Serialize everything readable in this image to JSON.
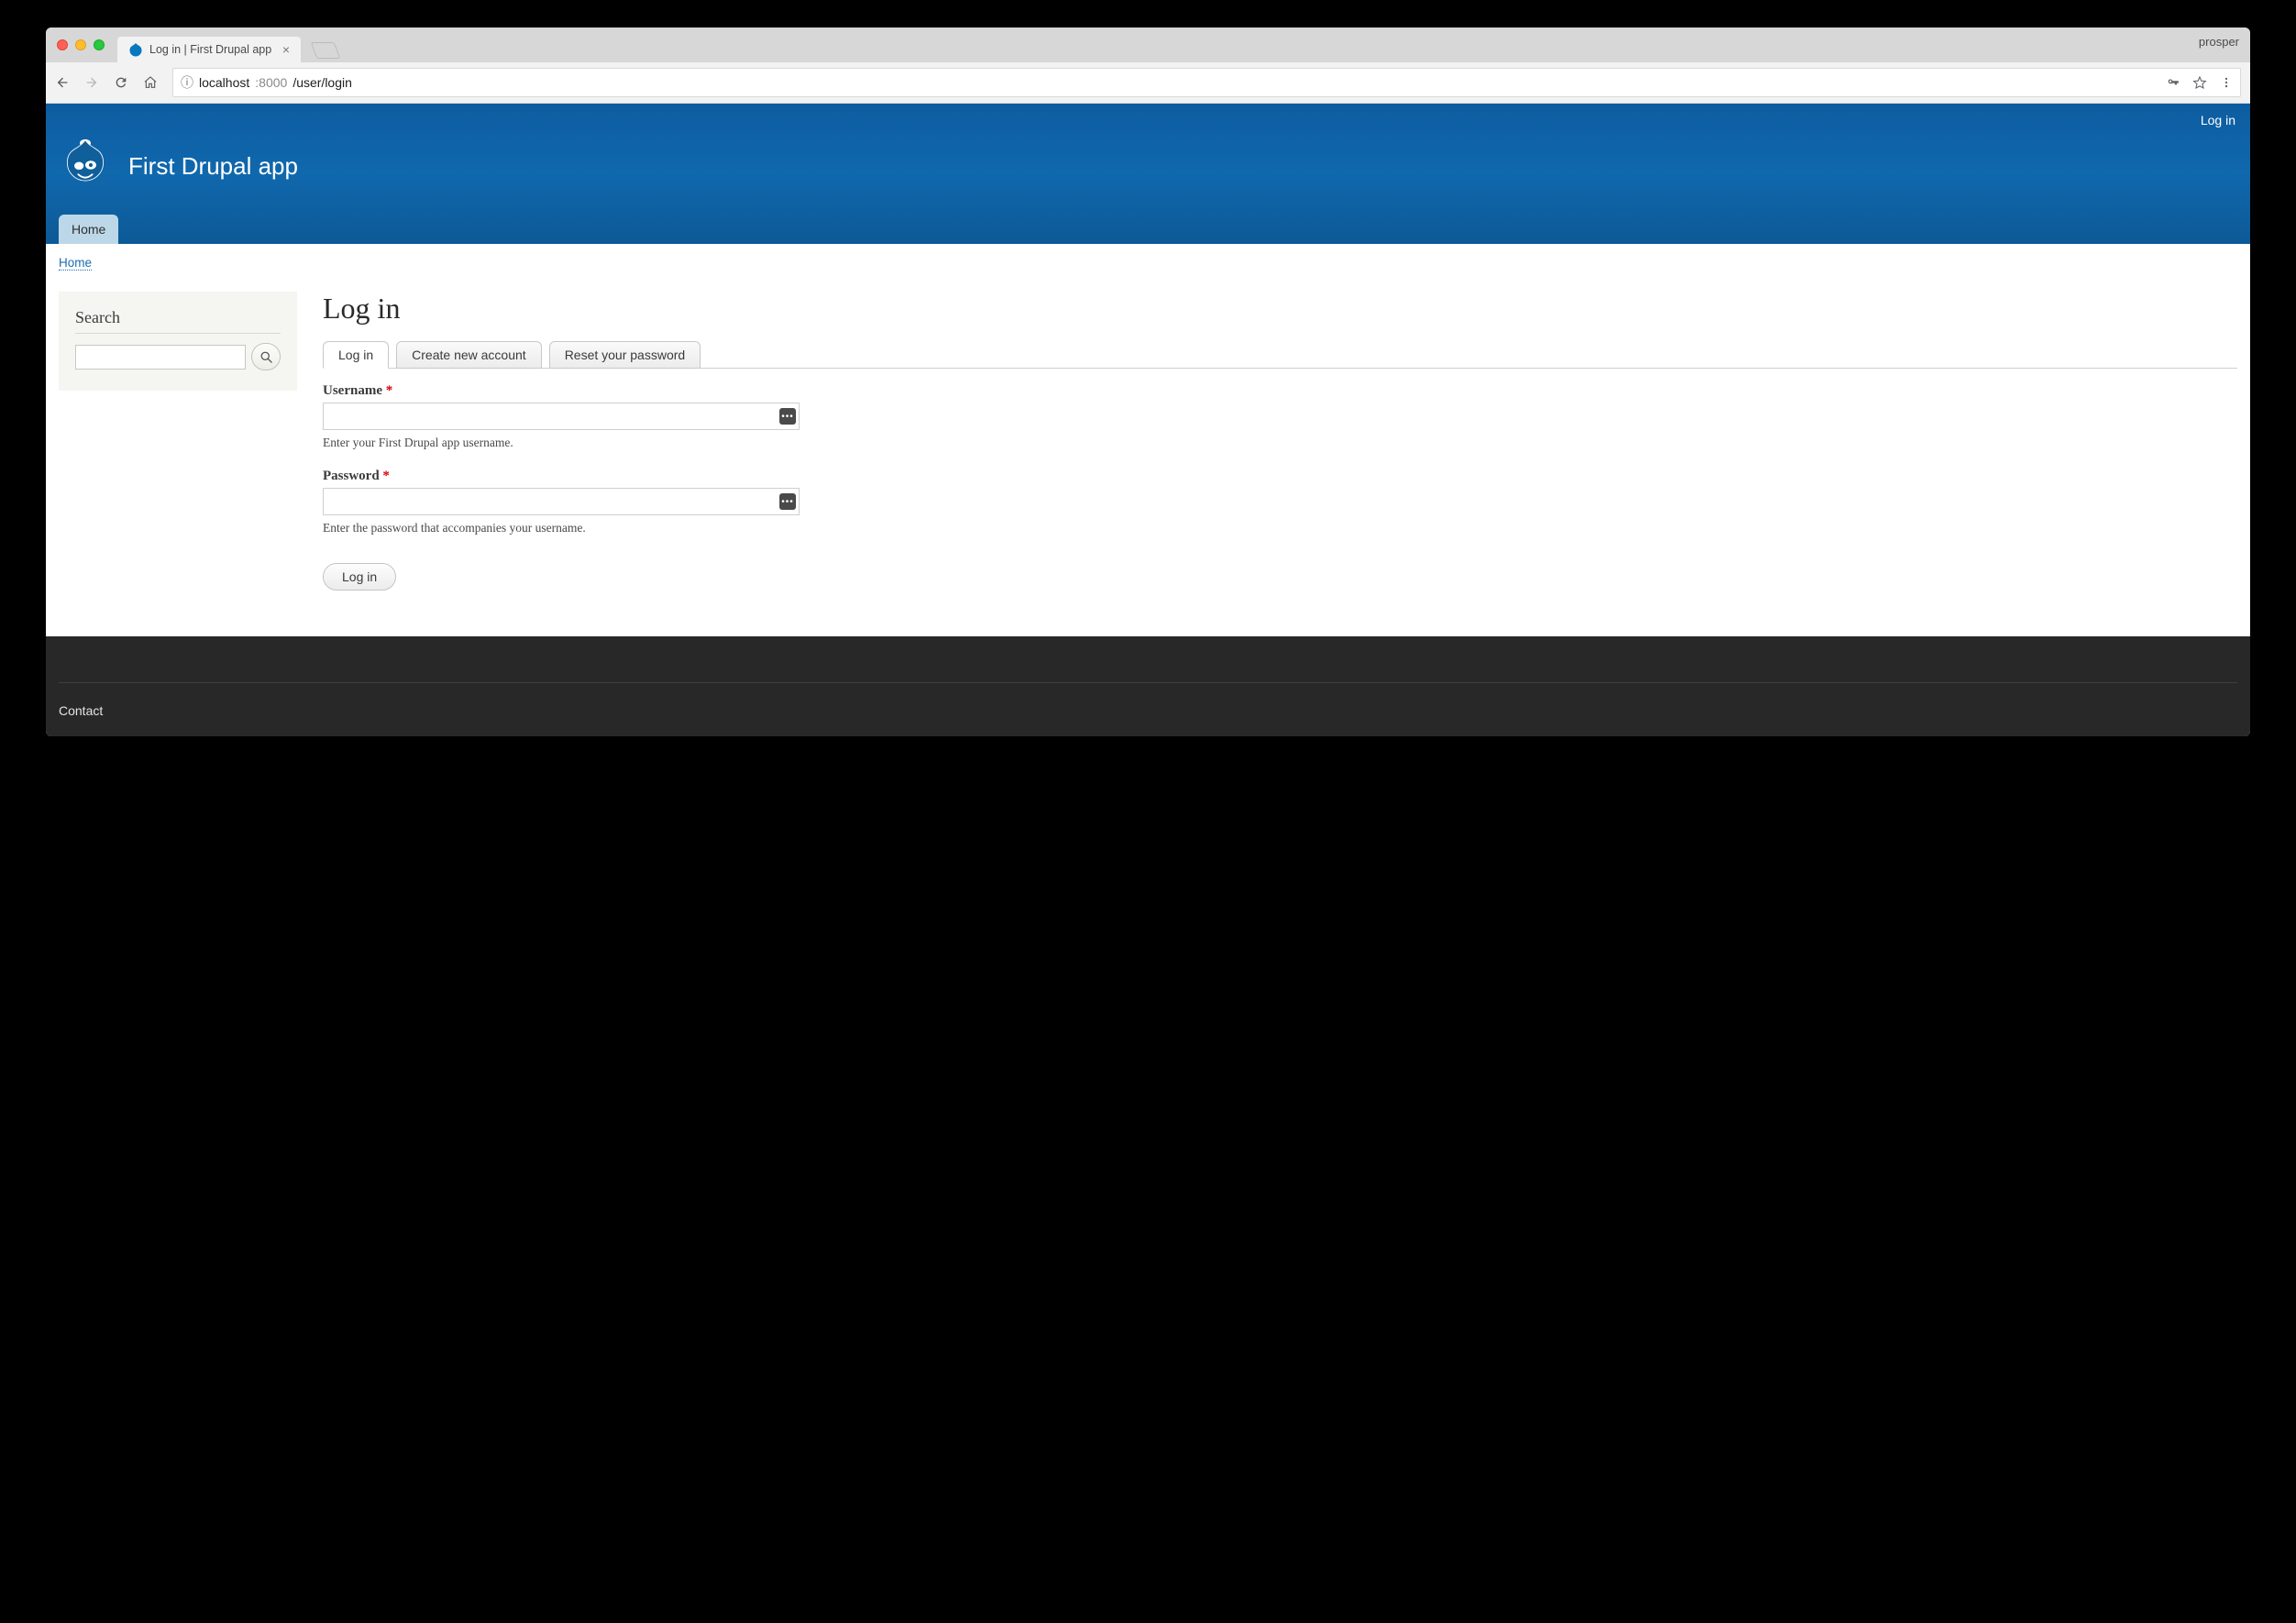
{
  "browser": {
    "tab_title": "Log in | First Drupal app",
    "system_menu_label": "prosper",
    "url": {
      "host": "localhost",
      "port": ":8000",
      "path": "/user/login"
    }
  },
  "header": {
    "login_link": "Log in",
    "site_name": "First Drupal app",
    "main_nav": {
      "home": "Home"
    }
  },
  "breadcrumb": {
    "home": "Home"
  },
  "sidebar": {
    "search_heading": "Search"
  },
  "page": {
    "title": "Log in",
    "tabs": [
      {
        "label": "Log in"
      },
      {
        "label": "Create new account"
      },
      {
        "label": "Reset your password"
      }
    ],
    "username": {
      "label": "Username",
      "required_marker": "*",
      "value": "",
      "help": "Enter your First Drupal app username."
    },
    "password": {
      "label": "Password",
      "required_marker": "*",
      "value": "",
      "help": "Enter the password that accompanies your username."
    },
    "submit_label": "Log in"
  },
  "footer": {
    "contact": "Contact"
  }
}
